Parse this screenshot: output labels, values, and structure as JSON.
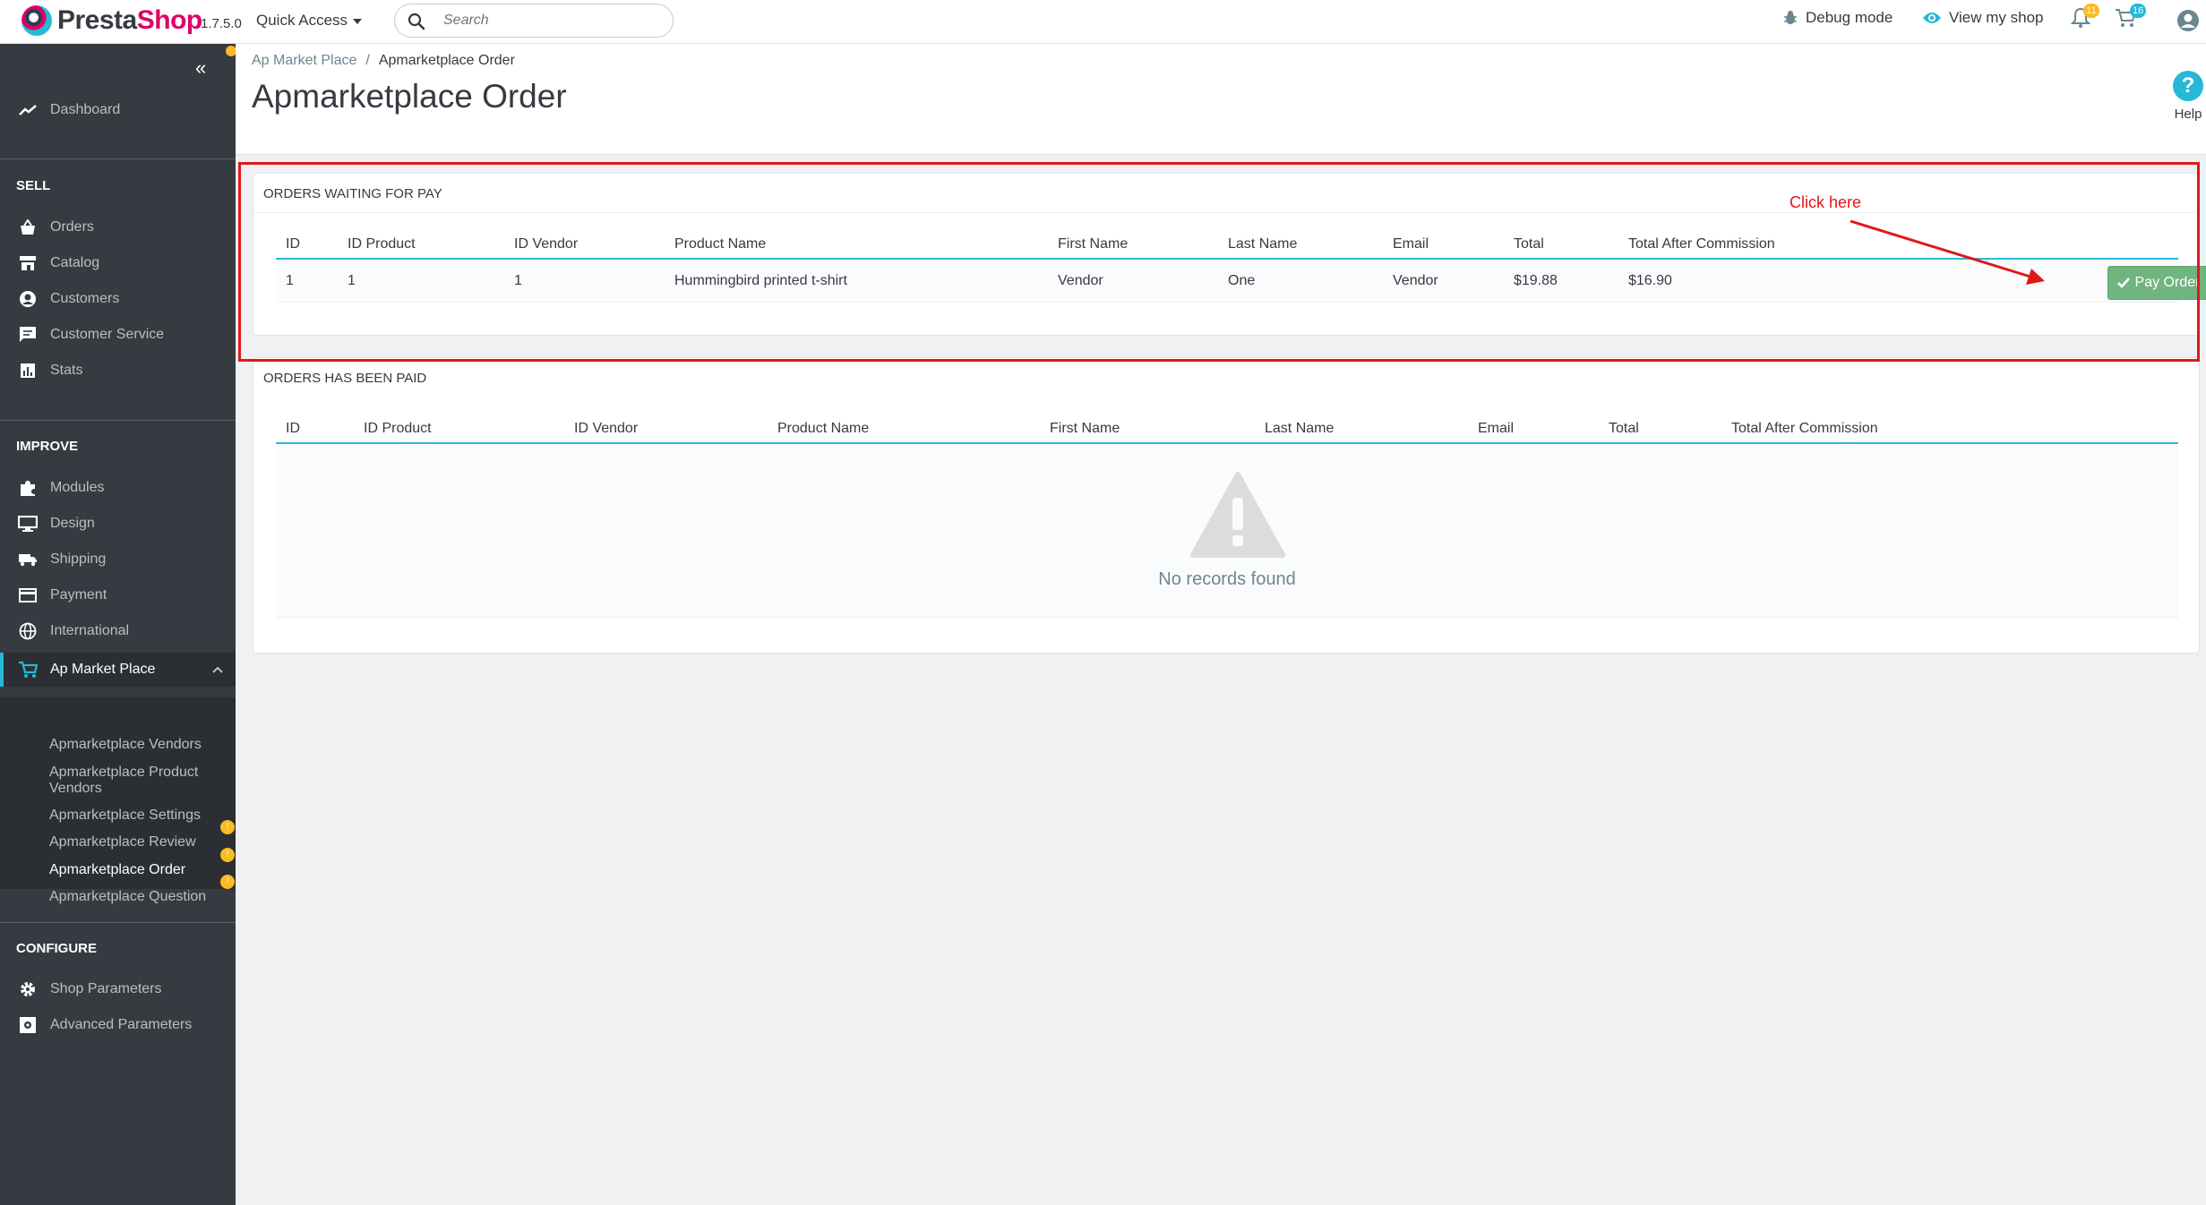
{
  "topbar": {
    "logo_text_main": "Presta",
    "logo_text_accent": "Shop",
    "version": "1.7.5.0",
    "quick_access": "Quick Access",
    "search_placeholder": "Search",
    "debug_mode": "Debug mode",
    "view_shop": "View my shop",
    "notifications_count": "11",
    "orders_count": "16"
  },
  "sidebar": {
    "dashboard": "Dashboard",
    "sections": {
      "sell": "SELL",
      "improve": "IMPROVE",
      "configure": "CONFIGURE"
    },
    "sell_items": [
      "Orders",
      "Catalog",
      "Customers",
      "Customer Service",
      "Stats"
    ],
    "improve_items": [
      "Modules",
      "Design",
      "Shipping",
      "Payment",
      "International",
      "Ap Market Place"
    ],
    "sub_items": [
      "Apmarketplace Vendors",
      "Apmarketplace Product Vendors",
      "Apmarketplace Settings",
      "Apmarketplace Review",
      "Apmarketplace Order",
      "Apmarketplace Question"
    ],
    "sub_badges": [
      "!",
      "!",
      "!"
    ],
    "configure_items": [
      "Shop Parameters",
      "Advanced Parameters"
    ]
  },
  "header": {
    "breadcrumb_parent": "Ap Market Place",
    "breadcrumb_separator": "/",
    "breadcrumb_current": "Apmarketplace Order",
    "title": "Apmarketplace Order",
    "help": "Help"
  },
  "waiting_panel": {
    "title": "ORDERS WAITING FOR PAY",
    "columns": [
      "ID",
      "ID Product",
      "ID Vendor",
      "Product Name",
      "First Name",
      "Last Name",
      "Email",
      "Total",
      "Total After Commission"
    ],
    "rows": [
      {
        "id": "1",
        "id_product": "1",
        "id_vendor": "1",
        "product_name": "Hummingbird printed t-shirt",
        "first_name": "Vendor",
        "last_name": "One",
        "email": "Vendor",
        "total": "$19.88",
        "total_after_commission": "$16.90",
        "action": "Pay Order"
      }
    ]
  },
  "paid_panel": {
    "title": "ORDERS HAS BEEN PAID",
    "columns": [
      "ID",
      "ID Product",
      "ID Vendor",
      "Product Name",
      "First Name",
      "Last Name",
      "Email",
      "Total",
      "Total After Commission"
    ],
    "empty_text": "No records found"
  },
  "annotation": {
    "text": "Click here",
    "color": "#e01818"
  },
  "colors": {
    "accent": "#25b9d7",
    "brand": "#df0067",
    "success": "#70b580",
    "sidebar_bg": "#363a41",
    "badge": "#fbbb22"
  }
}
